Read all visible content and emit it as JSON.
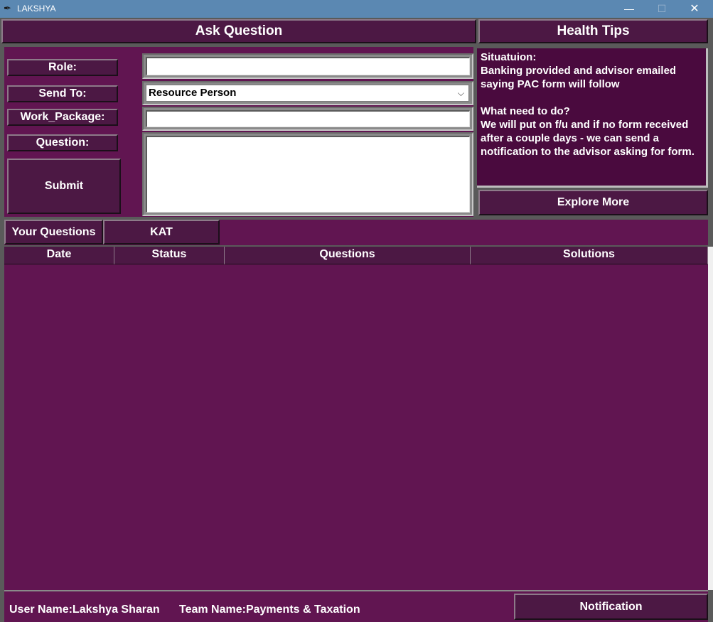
{
  "window": {
    "title": "LAKSHYA",
    "icon": "feather-icon",
    "controls": {
      "minimize": "—",
      "maximize": "☐",
      "close": "✕"
    }
  },
  "tabs": {
    "ask_question": "Ask Question",
    "health_tips": "Health Tips"
  },
  "form": {
    "role_label": "Role:",
    "send_to_label": "Send To:",
    "work_package_label": "Work_Package:",
    "question_label": "Question:",
    "submit_label": "Submit",
    "role_value": "",
    "send_to_value": "Resource Person",
    "work_package_value": "",
    "question_value": ""
  },
  "health_tips": {
    "text": "Situatuion:\nBanking provided and advisor emailed saying PAC form will follow\n\nWhat need to do?\nWe will put on f/u and if no form received after a couple days - we can send a notification to the advisor asking for form.",
    "explore_label": "Explore More"
  },
  "question_tabs": {
    "your_questions": "Your Questions",
    "kat": "KAT"
  },
  "table": {
    "columns": [
      "Date",
      "Status",
      "Questions",
      "Solutions"
    ],
    "rows": []
  },
  "footer": {
    "user_name": "User Name:Lakshya Sharan",
    "team_name": "Team Name:Payments & Taxation",
    "notification_label": "Notification"
  },
  "colors": {
    "panel": "#611551",
    "button": "#4c1844",
    "tips_panel": "#4a0a3e",
    "titlebar": "#5b88b2"
  }
}
